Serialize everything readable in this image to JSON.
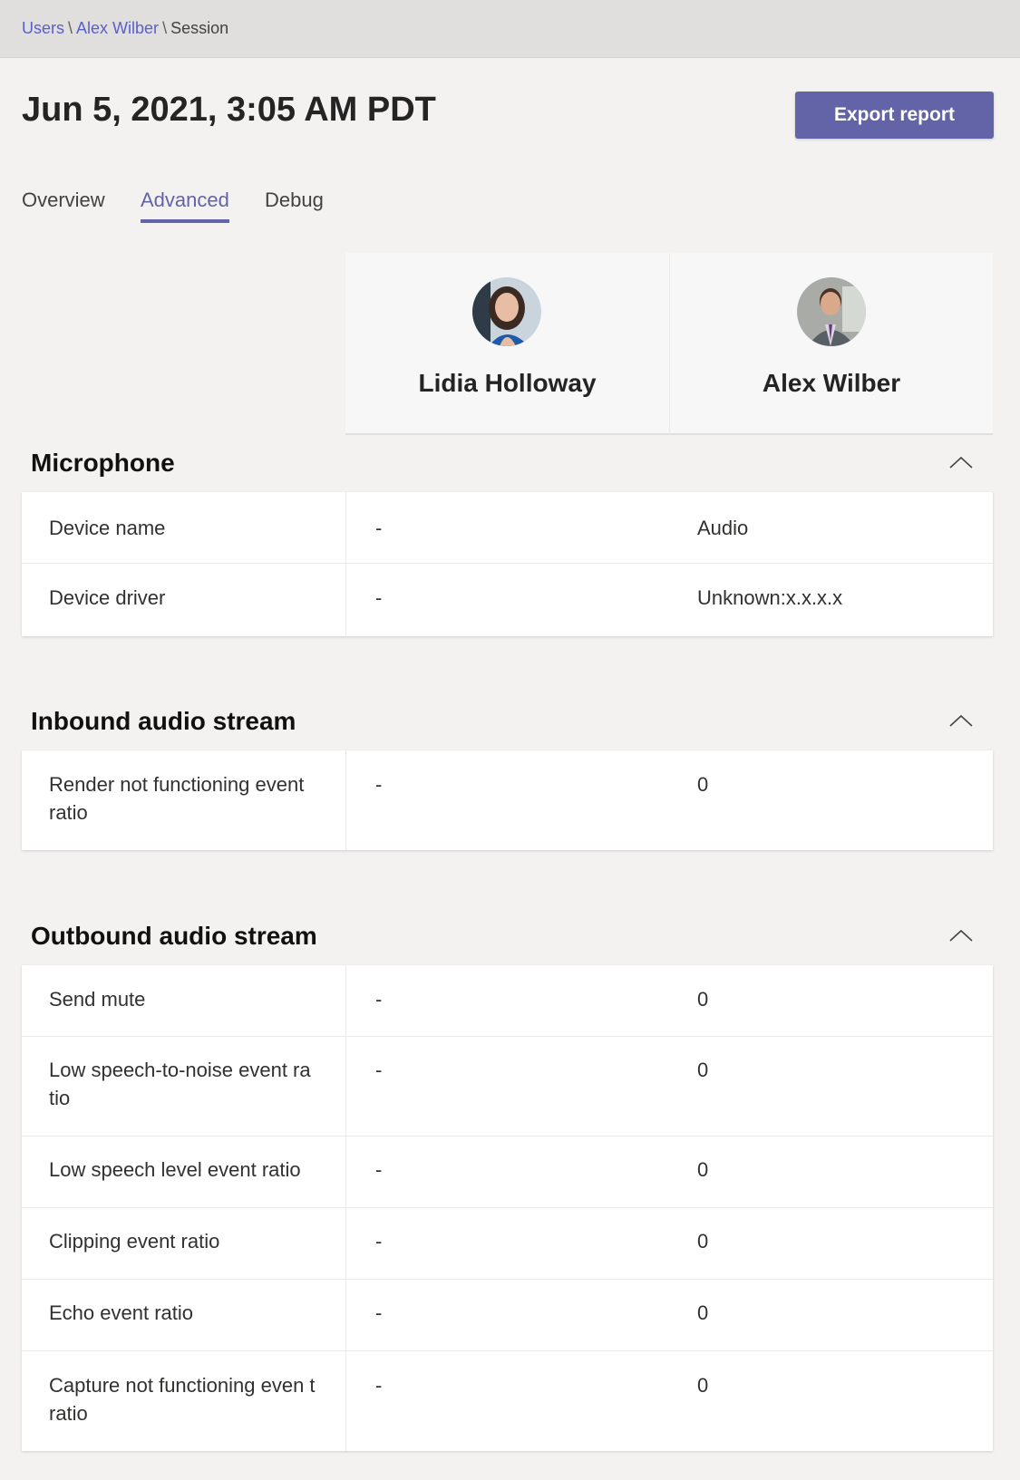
{
  "breadcrumb": {
    "items": [
      "Users",
      "Alex Wilber",
      "Session"
    ],
    "separator": "\\"
  },
  "header": {
    "title": "Jun 5, 2021, 3:05 AM PDT",
    "export_label": "Export report"
  },
  "tabs": [
    {
      "label": "Overview",
      "active": false
    },
    {
      "label": "Advanced",
      "active": true
    },
    {
      "label": "Debug",
      "active": false
    }
  ],
  "participants": [
    {
      "name": "Lidia Holloway",
      "avatar": "lidia-avatar"
    },
    {
      "name": "Alex Wilber",
      "avatar": "alex-avatar"
    }
  ],
  "sections": {
    "microphone": {
      "title": "Microphone",
      "rows": [
        {
          "label": "Device name",
          "v1": "-",
          "v2": "Audio"
        },
        {
          "label": "Device driver",
          "v1": "-",
          "v2": "Unknown:x.x.x.x"
        }
      ]
    },
    "inbound": {
      "title": "Inbound audio stream",
      "rows": [
        {
          "label": "Render not functioning event ratio",
          "v1": "-",
          "v2": "0"
        }
      ]
    },
    "outbound": {
      "title": "Outbound audio stream",
      "rows": [
        {
          "label": "Send mute",
          "v1": "-",
          "v2": "0"
        },
        {
          "label": "Low speech-to-noise event ra tio",
          "v1": "-",
          "v2": "0"
        },
        {
          "label": "Low speech level event ratio",
          "v1": "-",
          "v2": "0"
        },
        {
          "label": "Clipping event ratio",
          "v1": "-",
          "v2": "0"
        },
        {
          "label": "Echo event ratio",
          "v1": "-",
          "v2": "0"
        },
        {
          "label": "Capture not functioning even t ratio",
          "v1": "-",
          "v2": "0"
        }
      ]
    }
  },
  "colors": {
    "accent": "#6264a7",
    "link": "#5b5fc7",
    "background": "#f3f2f1"
  }
}
